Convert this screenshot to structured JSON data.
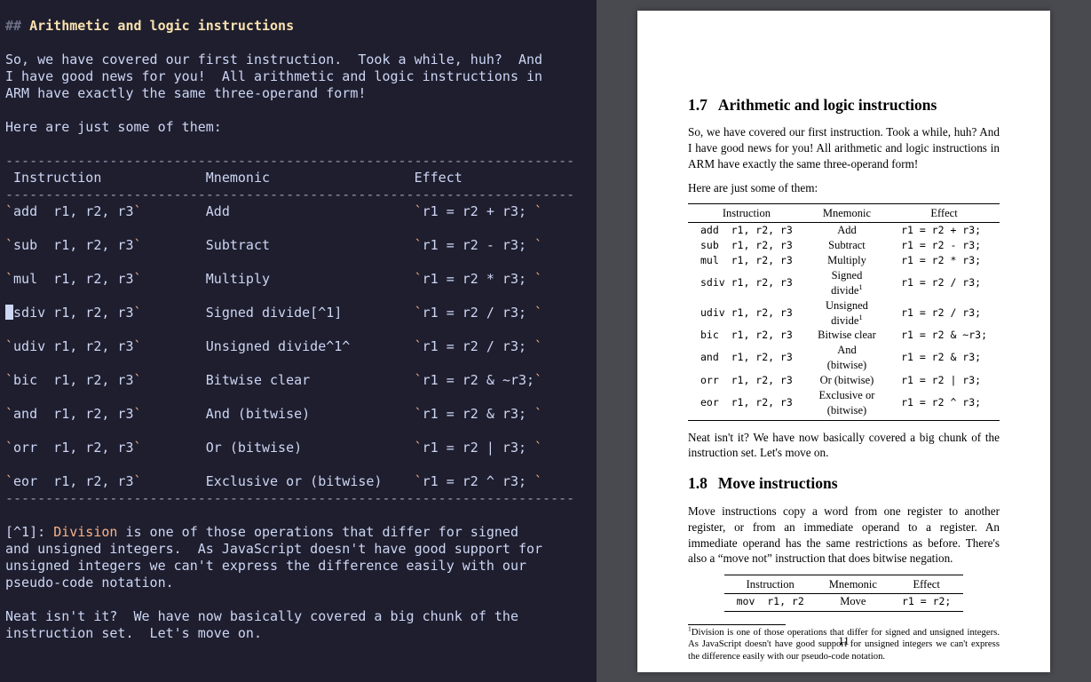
{
  "editor": {
    "heading_prefix": "## ",
    "heading_text": "Arithmetic and logic instructions",
    "intro": "So, we have covered our first instruction.  Took a while, huh?  And\nI have good news for you!  All arithmetic and logic instructions in\nARM have exactly the same three-operand form!",
    "listlead": "Here are just some of them:",
    "th_instruction": "Instruction",
    "th_mnemonic": "Mnemonic",
    "th_effect": "Effect",
    "rows": [
      {
        "code": "add  r1, r2, r3",
        "mnemonic": "Add",
        "effect": "r1 = r2 + r3; "
      },
      {
        "code": "sub  r1, r2, r3",
        "mnemonic": "Subtract",
        "effect": "r1 = r2 - r3; "
      },
      {
        "code": "mul  r1, r2, r3",
        "mnemonic": "Multiply",
        "effect": "r1 = r2 * r3; "
      },
      {
        "code": "sdiv r1, r2, r3",
        "mnemonic": "Signed divide[^1]",
        "effect": "r1 = r2 / r3; "
      },
      {
        "code": "udiv r1, r2, r3",
        "mnemonic": "Unsigned divide^1^",
        "effect": "r1 = r2 / r3; "
      },
      {
        "code": "bic  r1, r2, r3",
        "mnemonic": "Bitwise clear",
        "effect": "r1 = r2 & ~r3;"
      },
      {
        "code": "and  r1, r2, r3",
        "mnemonic": "And (bitwise)",
        "effect": "r1 = r2 & r3; "
      },
      {
        "code": "orr  r1, r2, r3",
        "mnemonic": "Or (bitwise)",
        "effect": "r1 = r2 | r3; "
      },
      {
        "code": "eor  r1, r2, r3",
        "mnemonic": "Exclusive or (bitwise)",
        "effect": "r1 = r2 ^ r3; "
      }
    ],
    "footnote_ref": "[^1]:",
    "footnote_linkword": "Division",
    "footnote_rest": " is one of those operations that differ for signed\nand unsigned integers.  As JavaScript doesn't have good support for\nunsigned integers we can't express the difference easily with our\npseudo-code notation.",
    "outro": "Neat isn't it?  We have now basically covered a big chunk of the\ninstruction set.  Let's move on."
  },
  "pdf": {
    "sec1_num": "1.7",
    "sec1_title": "Arithmetic and logic instructions",
    "p1": "So, we have covered our first instruction. Took a while, huh? And I have good news for you! All arithmetic and logic instructions in ARM have exactly the same three-operand form!",
    "p2": "Here are just some of them:",
    "th_instruction": "Instruction",
    "th_mnemonic": "Mnemonic",
    "th_effect": "Effect",
    "rows": [
      {
        "code": "add  r1, r2, r3",
        "mnemonic": "Add",
        "sup": "",
        "effect": "r1 = r2 + r3;"
      },
      {
        "code": "sub  r1, r2, r3",
        "mnemonic": "Subtract",
        "sup": "",
        "effect": "r1 = r2 - r3;"
      },
      {
        "code": "mul  r1, r2, r3",
        "mnemonic": "Multiply",
        "sup": "",
        "effect": "r1 = r2 * r3;"
      },
      {
        "code": "sdiv r1, r2, r3",
        "mnemonic": "Signed divide",
        "sup": "1",
        "effect": "r1 = r2 / r3;"
      },
      {
        "code": "udiv r1, r2, r3",
        "mnemonic": "Unsigned divide",
        "sup": "1",
        "effect": "r1 = r2 / r3;"
      },
      {
        "code": "bic  r1, r2, r3",
        "mnemonic": "Bitwise clear",
        "sup": "",
        "effect": "r1 = r2 & ~r3;"
      },
      {
        "code": "and  r1, r2, r3",
        "mnemonic": "And (bitwise)",
        "sup": "",
        "effect": "r1 = r2 & r3;"
      },
      {
        "code": "orr  r1, r2, r3",
        "mnemonic": "Or (bitwise)",
        "sup": "",
        "effect": "r1 = r2 | r3;"
      },
      {
        "code": "eor  r1, r2, r3",
        "mnemonic": "Exclusive or (bitwise)",
        "sup": "",
        "effect": "r1 = r2 ^ r3;"
      }
    ],
    "p3": "Neat isn't it? We have now basically covered a big chunk of the instruction set. Let's move on.",
    "sec2_num": "1.8",
    "sec2_title": "Move instructions",
    "p4": "Move instructions copy a word from one register to another register, or from an immediate operand to a register. An immediate operand has the same restrictions as before. There's also a “move not” instruction that does bitwise negation.",
    "rows2": [
      {
        "code": "mov  r1, r2",
        "mnemonic": "Move",
        "effect": "r1 = r2;"
      }
    ],
    "footnote": "Division is one of those operations that differ for signed and unsigned integers. As JavaScript doesn't have good support for unsigned integers we can't express the difference easily with our pseudo-code notation.",
    "footnote_num": "1",
    "pagenum": "11"
  }
}
